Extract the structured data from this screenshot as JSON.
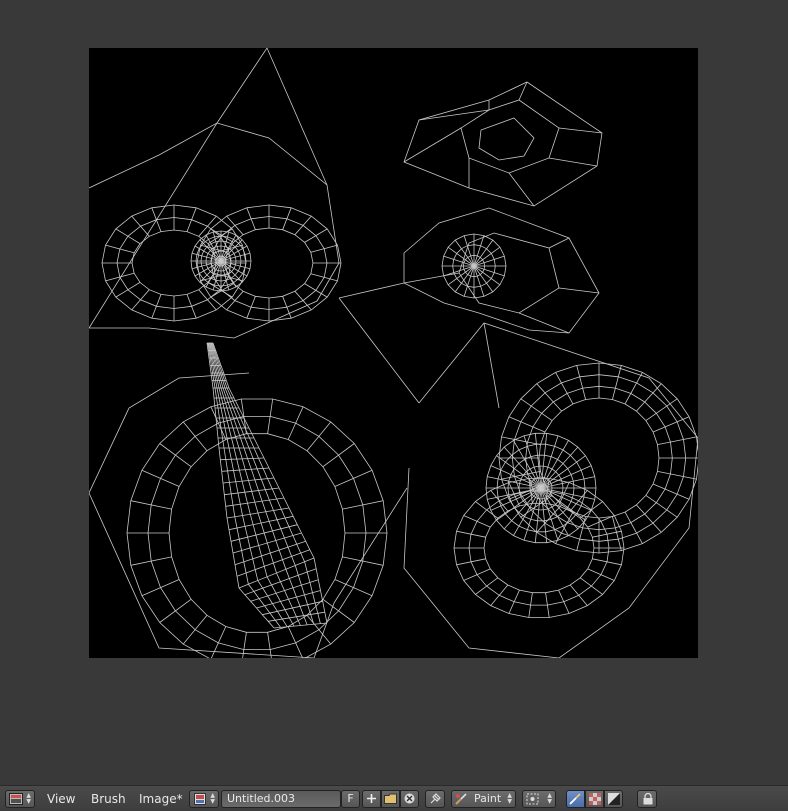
{
  "editor": {
    "type_icon": "image-editor-icon"
  },
  "menu": {
    "view": "View",
    "brush": "Brush",
    "image": "Image*"
  },
  "image": {
    "name": "Untitled.003",
    "fake_user": "F"
  },
  "mode": {
    "label": "Paint",
    "icon": "paint-icon"
  },
  "colors": {
    "canvas": "#000000",
    "uv_lines": "#c8c8c8",
    "background": "#393939",
    "active_blue": "#5b7fbf"
  }
}
